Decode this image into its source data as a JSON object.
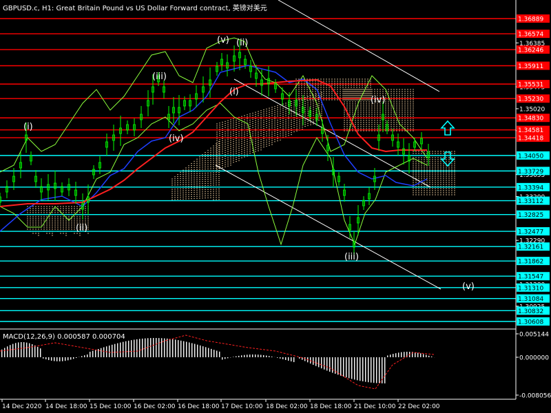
{
  "chart_title": "GBPUSD.c, H1:  Great Britain Pound vs US Dollar Forward contract, 英镑对美元",
  "macd_label": "MACD(12,26,9) 0.000587 0.000704",
  "colors": {
    "background": "#000000",
    "price_line": "#ffffff",
    "candles": "#00ff00",
    "resistance_lines": "#ff0000",
    "support_lines": "#00ffff",
    "ma_red": "#ff2020",
    "ma_blue": "#1f3fff",
    "ichimoku": "#ffdead",
    "envelope": "#8cff3c",
    "wave_labels": "#ffffff"
  },
  "price_axis": {
    "ticks": [
      "1.36385",
      "1.35475",
      "1.35020",
      "1.34565",
      "1.33655",
      "1.33200",
      "1.32290",
      "1.31380",
      "1.30925"
    ],
    "resistance_levels": [
      "1.36889",
      "1.36574",
      "1.36246",
      "1.35911",
      "1.35531",
      "1.35230",
      "1.34830",
      "1.34581",
      "1.34418"
    ],
    "support_levels": [
      "1.34050",
      "1.33729",
      "1.33394",
      "1.33112",
      "1.32825",
      "1.32477",
      "1.32161",
      "1.31862",
      "1.31547",
      "1.31310",
      "1.31084",
      "1.30832",
      "1.30608"
    ]
  },
  "macd_axis": {
    "ticks": [
      "0.005144",
      "0.000000",
      "-0.008056"
    ]
  },
  "time_axis": {
    "ticks": [
      "14 Dec 2020",
      "14 Dec 18:00",
      "15 Dec 10:00",
      "16 Dec 02:00",
      "16 Dec 18:00",
      "17 Dec 10:00",
      "18 Dec 02:00",
      "18 Dec 18:00",
      "21 Dec 10:00",
      "22 Dec 02:00"
    ]
  },
  "wave_labels": [
    "(i)",
    "(ii)",
    "(iii)",
    "(iv)",
    "(v)",
    "(ii)",
    "(i)",
    "(iii)",
    "(iv)",
    "(v)"
  ],
  "arrows": {
    "up": "up-arrow-icon",
    "down": "down-arrow-icon"
  }
}
